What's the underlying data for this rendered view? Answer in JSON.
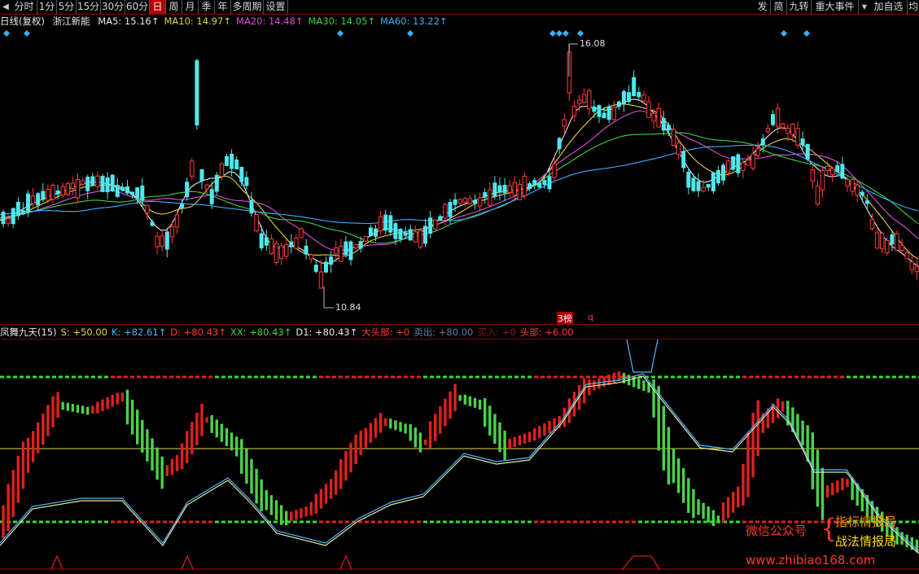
{
  "toolbar": {
    "left_icon": "◀",
    "periods": [
      {
        "label": "分时",
        "active": false
      },
      {
        "label": "1分",
        "active": false
      },
      {
        "label": "5分",
        "active": false
      },
      {
        "label": "15分",
        "active": false
      },
      {
        "label": "30分",
        "active": false
      },
      {
        "label": "60分",
        "active": false
      },
      {
        "label": "日",
        "active": true
      },
      {
        "label": "周",
        "active": false
      },
      {
        "label": "月",
        "active": false
      },
      {
        "label": "季",
        "active": false
      },
      {
        "label": "年",
        "active": false
      },
      {
        "label": "多周期",
        "active": false
      },
      {
        "label": "设置",
        "active": false
      }
    ],
    "right_buttons": [
      "发",
      "简",
      "九转",
      "重大事件",
      "加自选",
      "均线"
    ],
    "dropdown_icon": "▼",
    "prev_icon": "◀"
  },
  "legend": {
    "period_label": "日线(复权)",
    "stock_name": "浙江新能",
    "ma": [
      {
        "label": "MA5: 15.16↑",
        "color": "#e8e8e8"
      },
      {
        "label": "MA10: 14.97↑",
        "color": "#e5d33a"
      },
      {
        "label": "MA20: 14.48↑",
        "color": "#e04fe0"
      },
      {
        "label": "MA30: 14.05↑",
        "color": "#3fd23f"
      },
      {
        "label": "MA60: 13.22↑",
        "color": "#3ab0ff"
      }
    ]
  },
  "main": {
    "high_label": "16.08",
    "low_label": "10.84",
    "bottom_tag": "3榜",
    "bottom_tag2": "q"
  },
  "indicator": {
    "legend": [
      {
        "label": "凤舞九天(15)",
        "color": "#e8e8e8"
      },
      {
        "label": "S: +50.00",
        "color": "#e8d84a"
      },
      {
        "label": "K: +82.61↑",
        "color": "#4ab8ff"
      },
      {
        "label": "D: +80.43↑",
        "color": "#ff3a3a"
      },
      {
        "label": "XX: +80.43↑",
        "color": "#4ad24a"
      },
      {
        "label": "D1: +80.43↑",
        "color": "#e8e8e8"
      },
      {
        "label": "大头部: +0",
        "color": "#ff3a3a"
      },
      {
        "label": "卖出: +80.00",
        "color": "#5a7fa0"
      },
      {
        "label": "买入: +0",
        "color": "#8b1a1a"
      },
      {
        "label": "头部: +6.00",
        "color": "#ff3a3a"
      }
    ]
  },
  "watermark": {
    "wechat": "微信公众号",
    "brace": "{",
    "line1": "指标情报局",
    "line2": "战法情报局",
    "url": "www.zhibiao168.com"
  },
  "colors": {
    "up": "#ff3a3a",
    "down": "#4ee8ee",
    "ma5": "#e8e8e8",
    "ma10": "#e5d33a",
    "ma20": "#e04fe0",
    "ma30": "#3fd23f",
    "ma60": "#3ab0ff"
  }
}
